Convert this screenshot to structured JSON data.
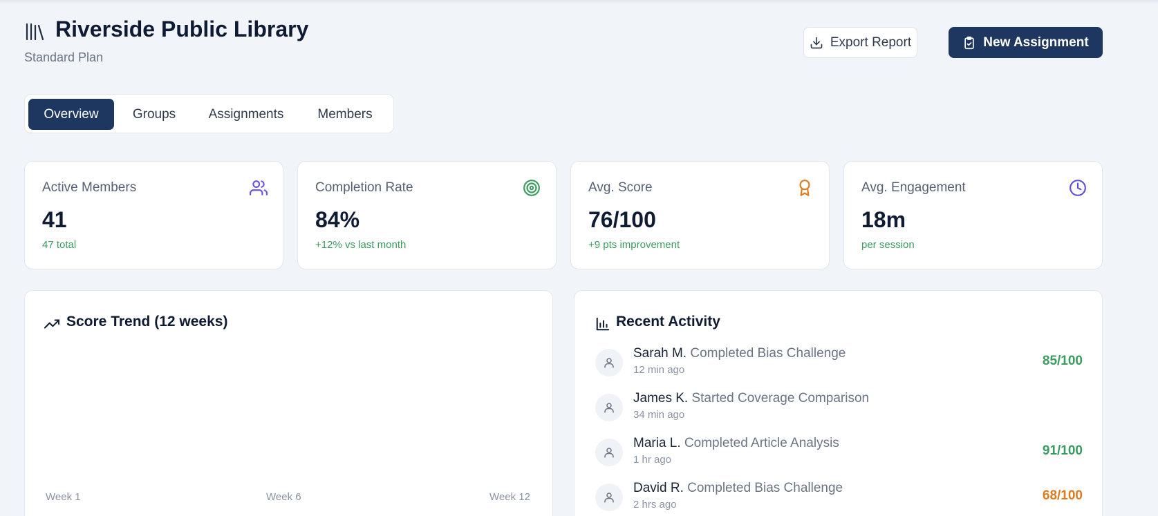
{
  "header": {
    "title": "Riverside Public Library",
    "subtitle": "Standard Plan",
    "icon": "library-icon",
    "export_label": "Export Report",
    "new_label": "New Assignment"
  },
  "tabs": [
    {
      "label": "Overview",
      "active": true
    },
    {
      "label": "Groups",
      "active": false
    },
    {
      "label": "Assignments",
      "active": false
    },
    {
      "label": "Members",
      "active": false
    }
  ],
  "stats": [
    {
      "label": "Active Members",
      "value": "41",
      "note": "47 total",
      "icon": "users-icon",
      "icon_color": "#6a54d9"
    },
    {
      "label": "Completion Rate",
      "value": "84%",
      "note": "+12% vs last month",
      "icon": "target-icon",
      "icon_color": "#3a9c5f"
    },
    {
      "label": "Avg. Score",
      "value": "76/100",
      "note": "+9 pts improvement",
      "icon": "award-icon",
      "icon_color": "#e07a1f"
    },
    {
      "label": "Avg. Engagement",
      "value": "18m",
      "note": "per session",
      "icon": "clock-icon",
      "icon_color": "#5b52d6"
    }
  ],
  "trend": {
    "title": "Score Trend (12 weeks)",
    "icon": "trending-up-icon",
    "axis": [
      "Week 1",
      "Week 6",
      "Week 12"
    ]
  },
  "activity": {
    "title": "Recent Activity",
    "icon": "bar-chart-icon",
    "items": [
      {
        "name": "Sarah M.",
        "action": "Completed Bias Challenge",
        "time": "12 min ago",
        "score": "85/100",
        "score_color": "#3a9c5f"
      },
      {
        "name": "James K.",
        "action": "Started Coverage Comparison",
        "time": "34 min ago",
        "score": "",
        "score_color": "#3a9c5f"
      },
      {
        "name": "Maria L.",
        "action": "Completed Article Analysis",
        "time": "1 hr ago",
        "score": "91/100",
        "score_color": "#3a9c5f"
      },
      {
        "name": "David R.",
        "action": "Completed Bias Challenge",
        "time": "2 hrs ago",
        "score": "68/100",
        "score_color": "#e07a1f"
      }
    ]
  },
  "colors": {
    "primary": "#1d3761",
    "background": "#f1f4f9",
    "positive": "#3a9c5f",
    "warning": "#e07a1f"
  }
}
